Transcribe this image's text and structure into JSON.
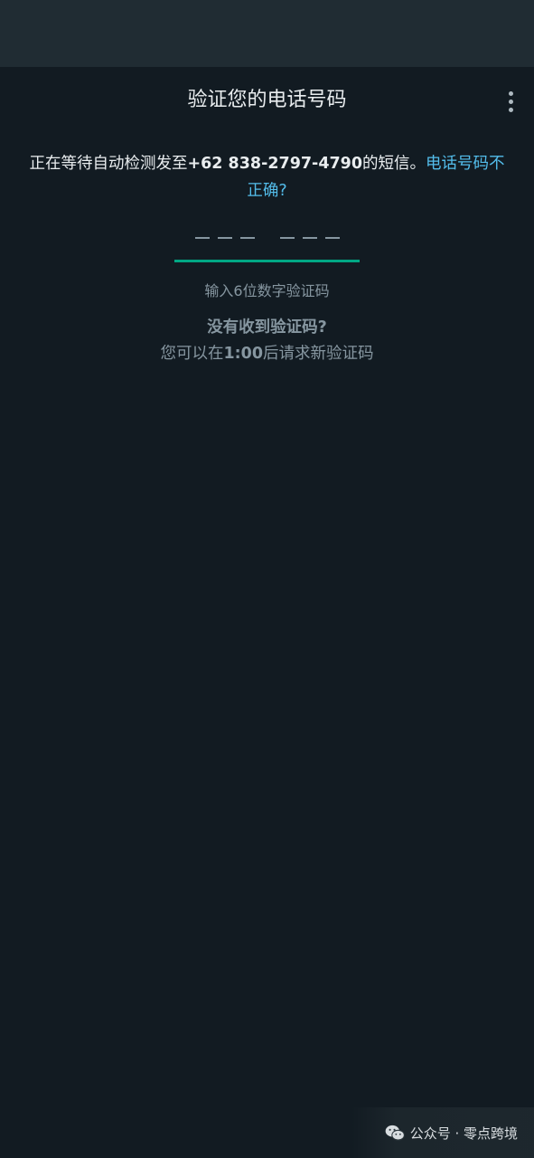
{
  "app_bar": {
    "title": "验证您的电话号码",
    "menu_icon": "more-vert-icon"
  },
  "info": {
    "prefix": "正在等待自动检测发至",
    "phone_number": "+62 838-2797-4790",
    "suffix": "的短信。",
    "wrong_number_link": "电话号码不正确?"
  },
  "code_input": {
    "placeholder_groups": [
      "— — —",
      "— — —"
    ],
    "hint": "输入6位数字验证码"
  },
  "resend": {
    "title": "没有收到验证码?",
    "prefix": "您可以在",
    "timer": "1:00",
    "suffix": "后请求新验证码"
  },
  "watermark": {
    "text": "公众号 · 零点跨境",
    "icon": "wechat-icon"
  },
  "colors": {
    "background": "#121b22",
    "status_bar": "#202c33",
    "accent": "#00a884",
    "link": "#53bdeb",
    "secondary_text": "#8696a0",
    "primary_text": "#e9edef"
  }
}
